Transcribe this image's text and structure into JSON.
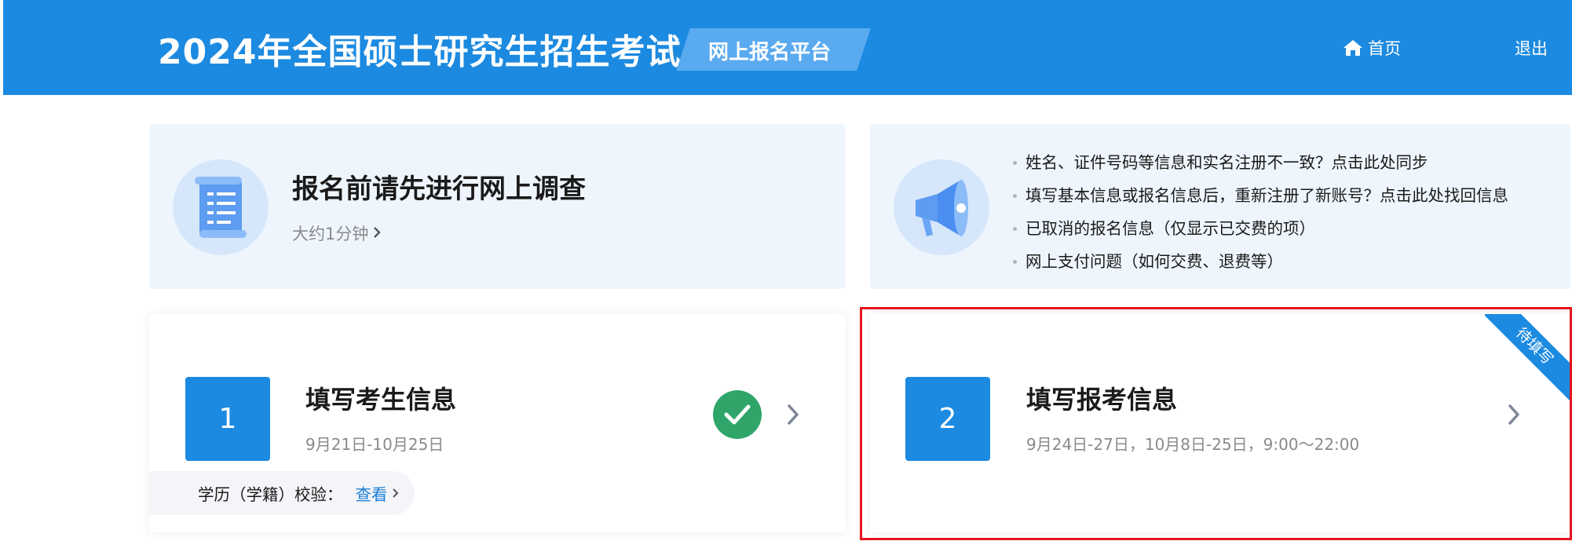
{
  "header": {
    "title": "2024年全国硕士研究生招生考试",
    "platform": "网上报名平台",
    "home_label": "首页",
    "logout_label": "退出"
  },
  "survey": {
    "title": "报名前请先进行网上调查",
    "subtitle": "大约1分钟"
  },
  "notices": {
    "items": [
      "姓名、证件号码等信息和实名注册不一致？点击此处同步",
      "填写基本信息或报名信息后，重新注册了新账号？点击此处找回信息",
      "已取消的报名信息（仅显示已交费的项）",
      "网上支付问题（如何交费、退费等）"
    ]
  },
  "steps": [
    {
      "number": "1",
      "title": "填写考生信息",
      "date": "9月21日-10月25日",
      "status": "completed",
      "verify_label": "学历（学籍）校验：",
      "verify_link": "查看"
    },
    {
      "number": "2",
      "title": "填写报考信息",
      "date": "9月24日-27日，10月8日-25日，9:00～22:00",
      "status": "pending",
      "badge": "待填写"
    }
  ],
  "colors": {
    "primary": "#1c8ae0",
    "success": "#2fa56a",
    "highlight": "#e6151e",
    "card_bg": "#eef5fd"
  },
  "icons": {
    "home": "home-icon",
    "survey": "scroll-document-icon",
    "notice": "megaphone-icon",
    "check": "check-circle-icon",
    "arrow": "chevron-right-icon"
  }
}
